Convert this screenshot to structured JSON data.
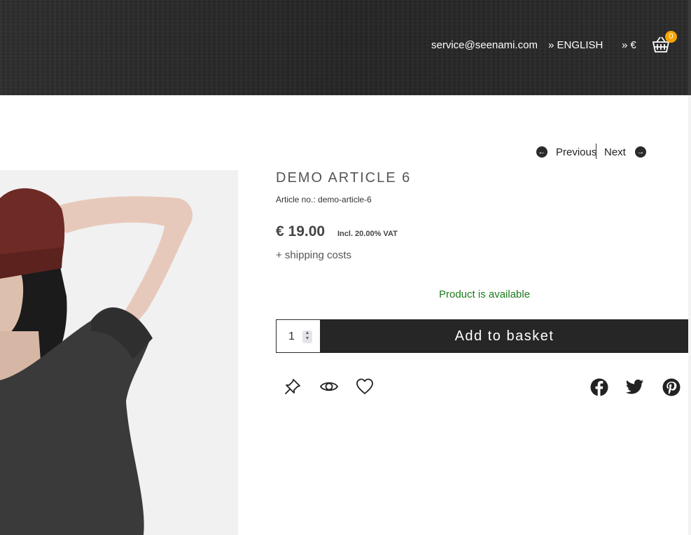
{
  "header": {
    "email": "service@seenami.com",
    "language": "» ENGLISH",
    "currency": "» €",
    "basket": {
      "icon": "basket-icon",
      "count": "0"
    }
  },
  "navigation": {
    "previous_label": "Previous",
    "next_label": "Next",
    "previous_icon": "arrow-left-icon",
    "next_icon": "arrow-right-icon"
  },
  "product": {
    "title": "DEMO ARTICLE 6",
    "article_no": "Article no.: demo-article-6",
    "price": "€ 19.00",
    "vat": "Incl. 20.00% VAT",
    "shipping": "+ shipping costs",
    "availability": "Product is available",
    "quantity": "1",
    "add_to_basket": "Add to basket"
  },
  "actions": {
    "icons": [
      "pin-icon",
      "eye-icon",
      "heart-icon"
    ]
  },
  "share": {
    "icons": [
      "facebook-icon",
      "twitter-icon",
      "pinterest-icon"
    ]
  },
  "colors": {
    "header_bg": "#2a2a2a",
    "basket_badge": "#f7a400",
    "button_bg": "#262626",
    "available_green": "#1b7a1b"
  }
}
